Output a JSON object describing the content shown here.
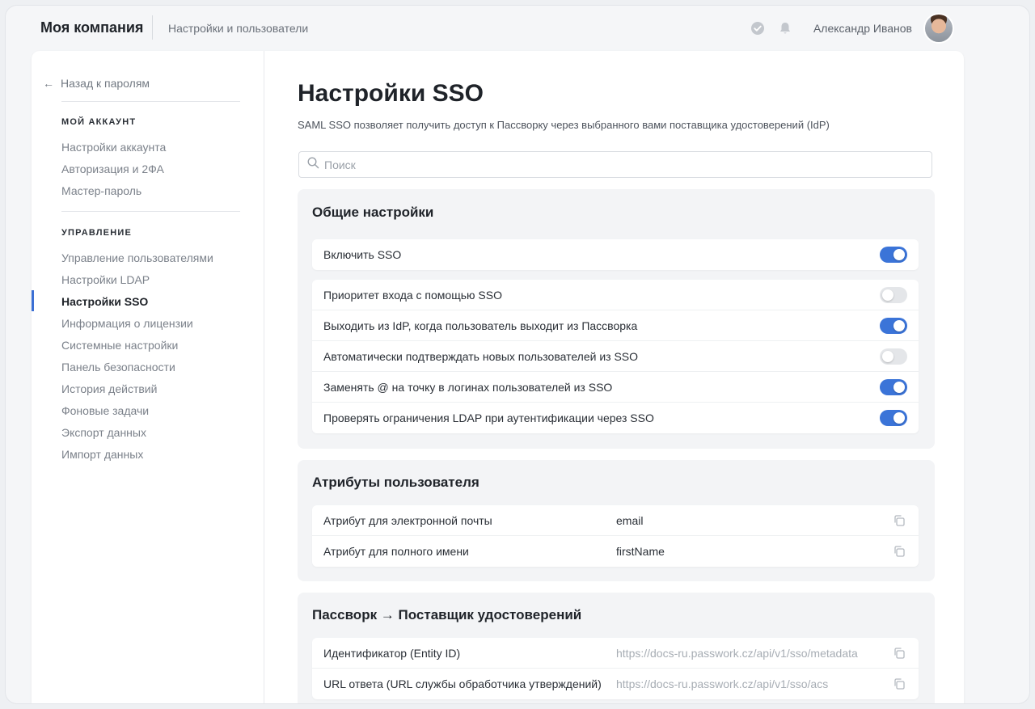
{
  "header": {
    "brand": "Моя компания",
    "section": "Настройки и пользователи",
    "user_name": "Александр Иванов",
    "icons": [
      "check-circle-icon",
      "bell-icon"
    ]
  },
  "sidebar": {
    "back_label": "Назад к паролям",
    "account_heading": "МОЙ АККАУНТ",
    "account_items": [
      "Настройки аккаунта",
      "Авторизация и 2ФА",
      "Мастер-пароль"
    ],
    "management_heading": "УПРАВЛЕНИЕ",
    "management_items": [
      "Управление пользователями",
      "Настройки LDAP",
      "Настройки SSO",
      "Информация о лицензии",
      "Системные настройки",
      "Панель безопасности",
      "История действий",
      "Фоновые задачи",
      "Экспорт данных",
      "Импорт данных"
    ],
    "active_item": "Настройки SSO"
  },
  "main": {
    "title": "Настройки SSO",
    "subtitle": "SAML SSO позволяет получить доступ к Пассворку через выбранного вами поставщика удостоверений (IdP)",
    "search_placeholder": "Поиск"
  },
  "general": {
    "title": "Общие настройки",
    "enable_label": "Включить SSO",
    "enable_on": true,
    "options": [
      {
        "label": "Приоритет входа с помощью SSO",
        "on": false
      },
      {
        "label": "Выходить из IdP, когда пользователь выходит из Пассворка",
        "on": true
      },
      {
        "label": "Автоматически подтверждать новых пользователей из SSO",
        "on": false
      },
      {
        "label": "Заменять @ на точку в логинах пользователей из SSO",
        "on": true
      },
      {
        "label": "Проверять ограничения LDAP при аутентификации через SSO",
        "on": true
      }
    ]
  },
  "attributes": {
    "title": "Атрибуты пользователя",
    "rows": [
      {
        "label": "Атрибут для электронной почты",
        "value": "email"
      },
      {
        "label": "Атрибут для полного имени",
        "value": "firstName"
      }
    ]
  },
  "idp": {
    "title": "Пассворк → Поставщик удостоверений",
    "rows": [
      {
        "label": "Идентификатор (Entity ID)",
        "value": "https://docs-ru.passwork.cz/api/v1/sso/metadata"
      },
      {
        "label": "URL ответа (URL службы обработчика утверждений)",
        "value": "https://docs-ru.passwork.cz/api/v1/sso/acs"
      }
    ]
  },
  "colors": {
    "accent": "#3b74d8",
    "toggle_off": "#e4e6e9"
  }
}
